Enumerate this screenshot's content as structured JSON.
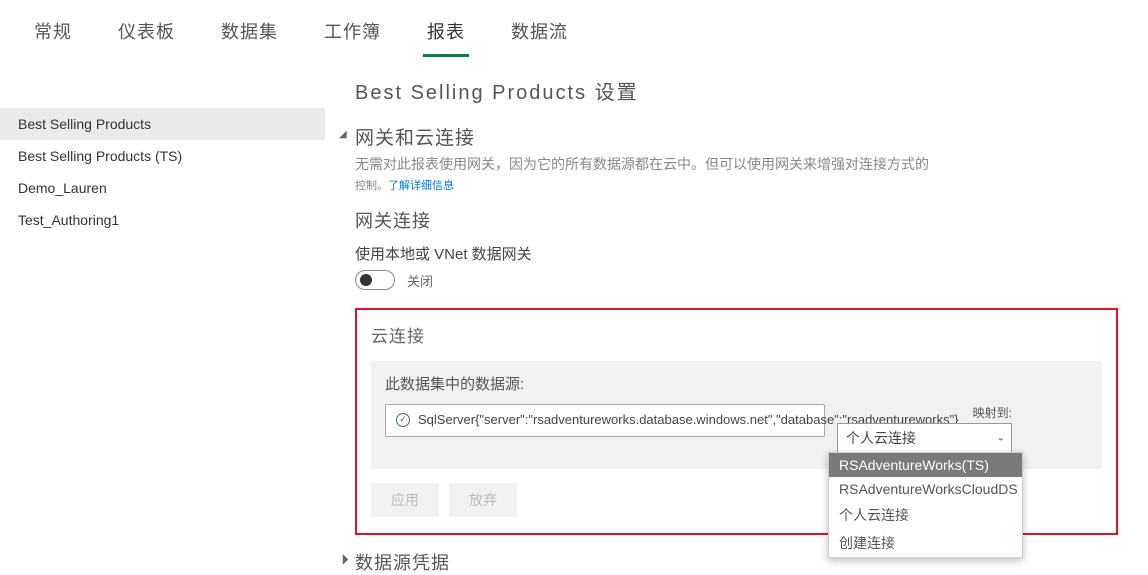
{
  "tabs": [
    {
      "label": "常规"
    },
    {
      "label": "仪表板"
    },
    {
      "label": "数据集"
    },
    {
      "label": "工作簿"
    },
    {
      "label": "报表",
      "active": true
    },
    {
      "label": "数据流"
    }
  ],
  "sidebar": {
    "items": [
      {
        "label": "Best Selling Products",
        "selected": true
      },
      {
        "label": "Best Selling Products (TS)"
      },
      {
        "label": "Demo_Lauren"
      },
      {
        "label": "Test_Authoring1"
      }
    ]
  },
  "main": {
    "title": "Best Selling Products 设置",
    "gateway": {
      "heading": "网关和云连接",
      "desc_line1": "无需对此报表使用网关，因为它的所有数据源都在云中。但可以使用网关来增强对连接方式的",
      "desc_line2_a": "控制。",
      "desc_line2_link": "了解详细信息",
      "sub_heading": "网关连接",
      "toggle_label": "使用本地或 VNet 数据网关",
      "toggle_state": "关闭"
    },
    "cloud": {
      "heading": "云连接",
      "panel_title": "此数据集中的数据源:",
      "datasource_text": "SqlServer{\"server\":\"rsadventureworks.database.windows.net\",\"database\":\"rsadventureworks\"}",
      "map_label": "映射到:",
      "map_selected": "个人云连接",
      "dropdown": [
        {
          "label": "RSAdventureWorks(TS)",
          "highlighted": true
        },
        {
          "label": "RSAdventureWorksCloudDS"
        },
        {
          "label": "个人云连接"
        },
        {
          "label": "创建连接"
        }
      ],
      "buttons": {
        "apply": "应用",
        "discard": "放弃"
      }
    },
    "credentials": {
      "heading": "数据源凭据"
    }
  }
}
